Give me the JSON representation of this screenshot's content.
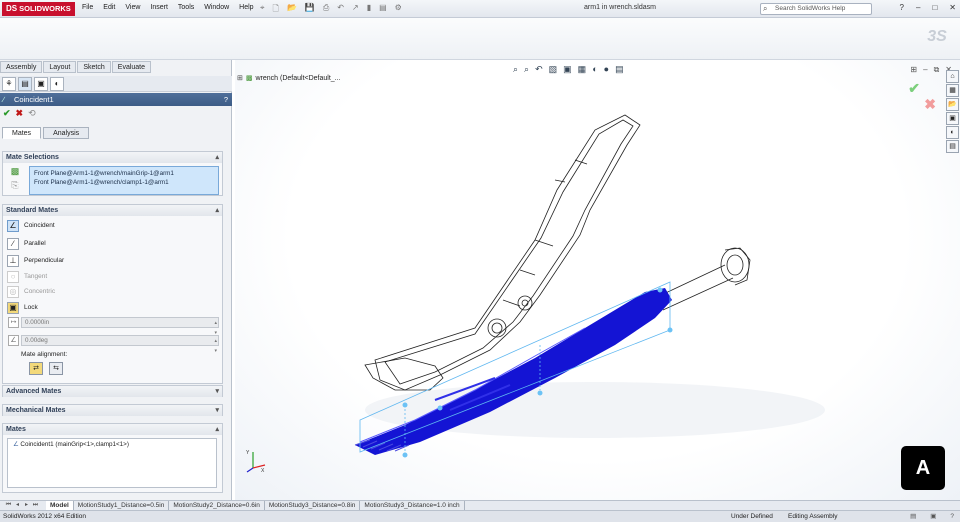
{
  "app": {
    "logo_text": "SOLIDWORKS",
    "logo_mark": "DS",
    "document_title": "arm1 in wrench.sldasm",
    "menu": [
      "File",
      "Edit",
      "View",
      "Insert",
      "Tools",
      "Window",
      "Help"
    ],
    "search_placeholder": "Search SolidWorks Help",
    "window_controls": [
      "?",
      "–",
      "□",
      "✕"
    ]
  },
  "command_tabs": [
    "Assembly",
    "Layout",
    "Sketch",
    "Evaluate"
  ],
  "property_manager": {
    "title": "Coincident1",
    "help_glyph": "?",
    "subtabs": [
      "Mates",
      "Analysis"
    ],
    "mate_selections": {
      "header": "Mate Selections",
      "items": [
        "Front Plane@Arm1-1@wrench/mainGrip-1@arm1",
        "Front Plane@Arm1-1@wrench/clamp1-1@arm1"
      ]
    },
    "standard_mates": {
      "header": "Standard Mates",
      "items": [
        {
          "label": "Coincident",
          "state": "active",
          "icon": "coincident-icon",
          "glyph": "∠"
        },
        {
          "label": "Parallel",
          "state": "normal",
          "icon": "parallel-icon",
          "glyph": "∕"
        },
        {
          "label": "Perpendicular",
          "state": "normal",
          "icon": "perpendicular-icon",
          "glyph": "⊥"
        },
        {
          "label": "Tangent",
          "state": "disabled",
          "icon": "tangent-icon",
          "glyph": "○"
        },
        {
          "label": "Concentric",
          "state": "disabled",
          "icon": "concentric-icon",
          "glyph": "◎"
        },
        {
          "label": "Lock",
          "state": "normal",
          "icon": "lock-icon",
          "glyph": "▣"
        }
      ],
      "distance_value": "0.0000in",
      "angle_value": "0.00deg",
      "alignment_label": "Mate alignment:"
    },
    "advanced_mates_header": "Advanced Mates",
    "mechanical_mates_header": "Mechanical Mates",
    "mates": {
      "header": "Mates",
      "items": [
        "Coincident1 (mainGrip<1>,clamp1<1>)"
      ]
    }
  },
  "graphics": {
    "tree_root_label": "wrench  (Default<Default_...",
    "watermark_text": "A"
  },
  "model_tabs": [
    "Model",
    "MotionStudy1_Distance=0.5in",
    "MotionStudy2_Distance=0.6in",
    "MotionStudy3_Distance=0.8in",
    "MotionStudy3_Distance=1.0 inch"
  ],
  "status": {
    "edition": "SolidWorks 2012 x64 Edition",
    "definition": "Under Defined",
    "mode": "Editing Assembly"
  },
  "colors": {
    "accent_blue": "#1414d4",
    "selection_bg": "#cfe6fb",
    "header_blue": "#3d5c86",
    "logo_red": "#c8102e"
  }
}
